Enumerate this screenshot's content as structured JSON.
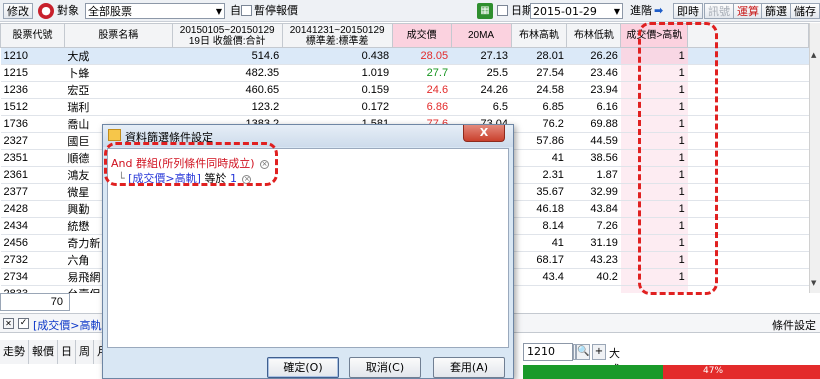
{
  "toolbar": {
    "modify_label": "修改",
    "target_label": "對象",
    "target_value": "全部股票",
    "self_label": "自",
    "pause_label": "暫停報價",
    "date_label": "日期",
    "date_value": "2015-01-29",
    "advanced_label": "進階",
    "realtime_label": "即時",
    "signal_label": "訊號",
    "calc_label": "運算",
    "filter_label": "篩選",
    "save_label": "儲存"
  },
  "table": {
    "headers": [
      "股票代號",
      "股票名稱",
      "20150105~20150129\n19日 收盤價:合計",
      "20141231~20150129\n標準差:標準差",
      "成交價",
      "20MA",
      "布林高軌",
      "布林低軌",
      "成交價>高軌"
    ],
    "rows": [
      [
        "1210",
        "大成",
        "514.6",
        "0.438",
        "28.05",
        "27.13",
        "28.01",
        "26.26",
        "1"
      ],
      [
        "1215",
        "卜蜂",
        "482.35",
        "1.019",
        "27.7",
        "25.5",
        "27.54",
        "23.46",
        "1"
      ],
      [
        "1236",
        "宏亞",
        "460.65",
        "0.159",
        "24.6",
        "24.26",
        "24.58",
        "23.94",
        "1"
      ],
      [
        "1512",
        "瑞利",
        "123.2",
        "0.172",
        "6.86",
        "6.5",
        "6.85",
        "6.16",
        "1"
      ],
      [
        "1736",
        "喬山",
        "1383.2",
        "1.581",
        "77.6",
        "73.04",
        "76.2",
        "69.88",
        "1"
      ],
      [
        "2327",
        "國巨",
        "",
        "",
        "",
        "",
        "57.86",
        "44.59",
        "1"
      ],
      [
        "2351",
        "順德",
        "",
        "",
        "",
        "",
        "41",
        "38.56",
        "1"
      ],
      [
        "2361",
        "鴻友",
        "",
        "",
        "",
        "",
        "2.31",
        "1.87",
        "1"
      ],
      [
        "2377",
        "微星",
        "",
        "",
        "",
        "",
        "35.67",
        "32.99",
        "1"
      ],
      [
        "2428",
        "興勤",
        "",
        "",
        "",
        "",
        "46.18",
        "43.84",
        "1"
      ],
      [
        "2434",
        "統懋",
        "",
        "",
        "",
        "",
        "8.14",
        "7.26",
        "1"
      ],
      [
        "2456",
        "奇力新",
        "",
        "",
        "",
        "",
        "41",
        "31.19",
        "1"
      ],
      [
        "2732",
        "六角",
        "",
        "",
        "",
        "",
        "68.17",
        "43.23",
        "1"
      ],
      [
        "2734",
        "易飛網",
        "",
        "",
        "",
        "",
        "43.4",
        "40.2",
        "1"
      ],
      [
        "2833",
        "台壽保",
        "",
        "",
        "",
        "",
        "",
        "",
        ""
      ]
    ]
  },
  "row_count": "70",
  "condition_bar": {
    "label": "[成交價>高軌]",
    "settings_label": "條件設定"
  },
  "bottom_tabs": [
    "走勢",
    "報價",
    "日",
    "周",
    "月"
  ],
  "stock_picker": {
    "code": "1210",
    "name": "大成"
  },
  "progress": {
    "percent": 47,
    "label": "47%"
  },
  "dialog": {
    "title": "資料篩選條件設定",
    "close_label": "X",
    "group_line": "And 群組(所列條件同時成立)",
    "cond_field": "[成交價>高軌]",
    "cond_op": "等於",
    "cond_value": "1",
    "ok_label": "確定(O)",
    "cancel_label": "取消(C)",
    "apply_label": "套用(A)"
  },
  "colors": {
    "up": "#e32b2b",
    "down": "#14941e",
    "highlight": "#e02020",
    "selected_row": "#dbe9f8"
  }
}
